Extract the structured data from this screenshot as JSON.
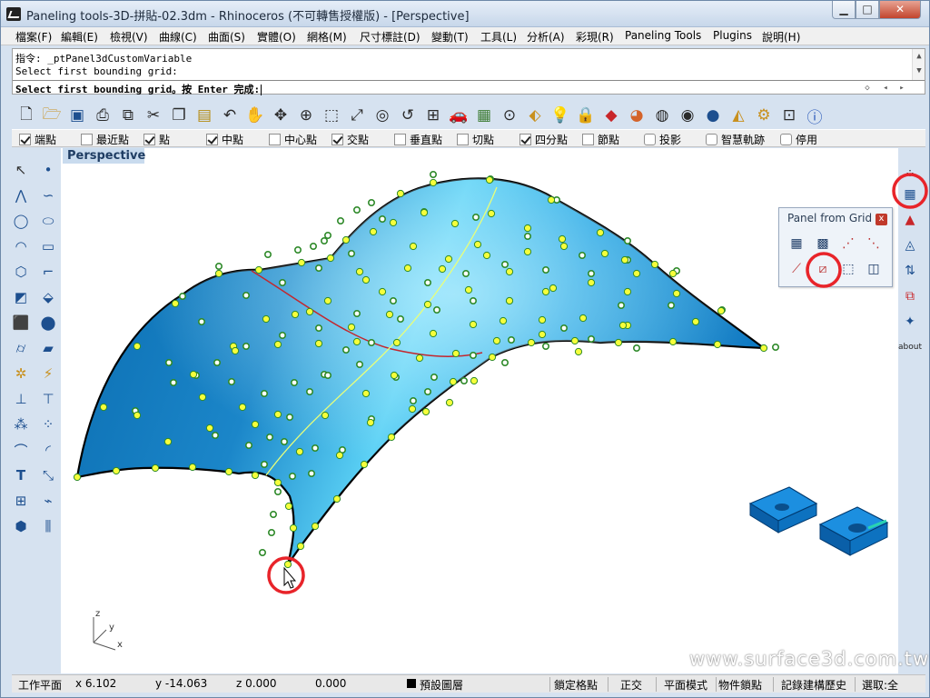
{
  "window": {
    "title": "Paneling tools-3D-拼貼-02.3dm - Rhinoceros (不可轉售授權版) - [Perspective]",
    "minimize_label": "▁",
    "maximize_label": "□",
    "close_label": "✕"
  },
  "menu": {
    "items": [
      "檔案(F)",
      "編輯(E)",
      "檢視(V)",
      "曲線(C)",
      "曲面(S)",
      "實體(O)",
      "網格(M)",
      "尺寸標註(D)",
      "變動(T)",
      "工具(L)",
      "分析(A)",
      "彩現(R)",
      "Paneling Tools",
      "Plugins",
      "說明(H)"
    ]
  },
  "command": {
    "history": [
      "指令: _ptPanel3dCustomVariable",
      "Select first bounding grid:"
    ],
    "prompt": "Select first bounding grid。按 Enter 完成:",
    "scroll_up": "▲",
    "scroll_down": "▼",
    "nav": [
      "◇",
      "◂",
      "▸"
    ]
  },
  "osnap": {
    "items": [
      {
        "label": "端點",
        "checked": true
      },
      {
        "label": "最近點",
        "checked": false
      },
      {
        "label": "點",
        "checked": true
      },
      {
        "label": "中點",
        "checked": true
      },
      {
        "label": "中心點",
        "checked": false
      },
      {
        "label": "交點",
        "checked": true
      },
      {
        "label": "垂直點",
        "checked": false
      },
      {
        "label": "切點",
        "checked": false
      },
      {
        "label": "四分點",
        "checked": true
      },
      {
        "label": "節點",
        "checked": false
      }
    ],
    "toggles": [
      "投影",
      "智慧軌跡",
      "停用"
    ]
  },
  "viewport": {
    "name": "Perspective",
    "axis_z": "z",
    "axis_y": "y",
    "axis_x": "x",
    "watermark": "www.surface3d.com.tw"
  },
  "panel": {
    "title": "Panel from Grid",
    "close_label": "x"
  },
  "right_toolbar": {
    "about_label": "about"
  },
  "status": {
    "cplane": "工作平面",
    "x": "x 6.102",
    "y": "y -14.063",
    "z": "z 0.000",
    "extra": "0.000",
    "layer": "預設圖層",
    "grid_snap": "鎖定格點",
    "ortho": "正交",
    "planar": "平面模式",
    "osnap": "物件鎖點",
    "history": "記錄建構歷史",
    "filter": "選取:全"
  },
  "colors": {
    "surface_light": "#2fb7ef",
    "surface_dark": "#0b6fb4",
    "point_fill": "#f6ff3b",
    "point_stroke": "#2f8a2a",
    "highlight_circle": "#e8242a",
    "seam_red": "#c3262d",
    "iso_yellow": "#e8ff7a"
  }
}
